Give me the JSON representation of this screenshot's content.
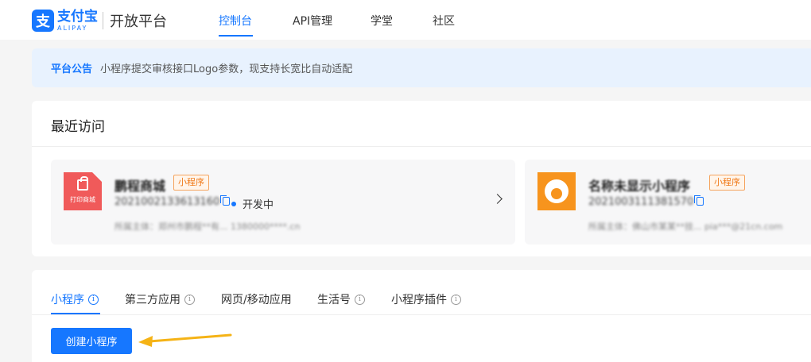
{
  "header": {
    "logo_cn": "支付宝",
    "logo_en": "ALIPAY",
    "platform": "开放平台",
    "nav": [
      {
        "label": "控制台",
        "active": true
      },
      {
        "label": "API管理",
        "active": false
      },
      {
        "label": "学堂",
        "active": false
      },
      {
        "label": "社区",
        "active": false
      }
    ]
  },
  "notice": {
    "title": "平台公告",
    "text": "小程序提交审核接口Logo参数，现支持长宽比自动适配"
  },
  "recent": {
    "title": "最近访问",
    "cards": [
      {
        "icon": "shopping-bag-icon",
        "icon_text": "打印商城",
        "name": "鹏程商城",
        "tag": "小程序",
        "id": "2021002133613160",
        "status": "开发中",
        "owner": "所属主体：郑州市鹏程**有...    1380000****.cn"
      },
      {
        "icon": "avatar-face-icon",
        "name": "名称未显示小程序",
        "tag": "小程序",
        "id": "2021003111381570",
        "owner": "所属主体：佛山市某某**技...    pia***@21cn.com"
      }
    ]
  },
  "tabs": [
    {
      "label": "小程序",
      "info": "i",
      "active": true
    },
    {
      "label": "第三方应用",
      "info": "i",
      "active": false
    },
    {
      "label": "网页/移动应用",
      "info": "",
      "active": false
    },
    {
      "label": "生活号",
      "info": "i",
      "active": false
    },
    {
      "label": "小程序插件",
      "info": "i",
      "active": false
    }
  ],
  "create_button": "创建小程序",
  "colors": {
    "accent": "#1677ff",
    "tag": "#f07b1b",
    "annotation_arrow": "#f5b316"
  }
}
